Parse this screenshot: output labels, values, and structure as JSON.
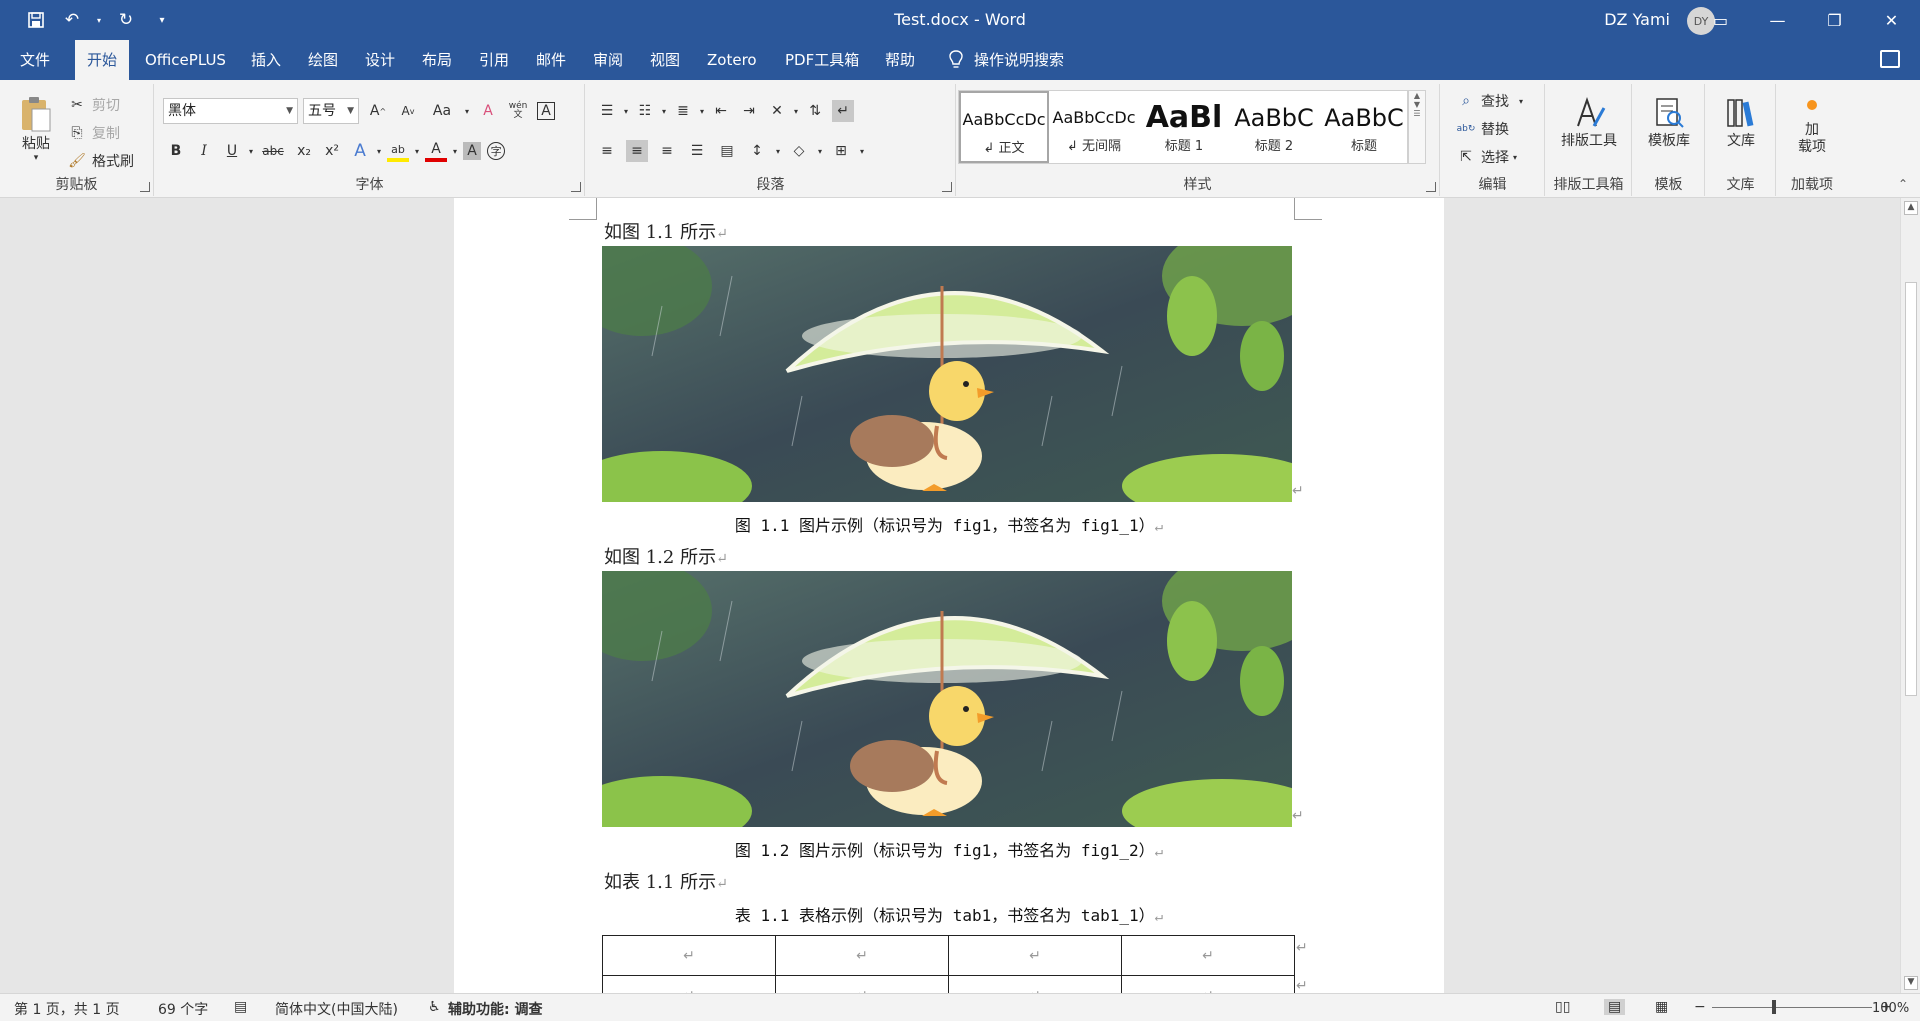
{
  "window": {
    "title": "Test.docx - Word",
    "user_name": "DZ Yami",
    "user_initials": "DY"
  },
  "tabs": [
    {
      "label": "文件"
    },
    {
      "label": "开始"
    },
    {
      "label": "OfficePLUS"
    },
    {
      "label": "插入"
    },
    {
      "label": "绘图"
    },
    {
      "label": "设计"
    },
    {
      "label": "布局"
    },
    {
      "label": "引用"
    },
    {
      "label": "邮件"
    },
    {
      "label": "审阅"
    },
    {
      "label": "视图"
    },
    {
      "label": "Zotero"
    },
    {
      "label": "PDF工具箱"
    },
    {
      "label": "帮助"
    }
  ],
  "active_tab": "开始",
  "tell_me": "操作说明搜索",
  "clipboard": {
    "paste": "粘贴",
    "cut": "剪切",
    "copy": "复制",
    "format_painter": "格式刷",
    "label": "剪贴板"
  },
  "font": {
    "name": "黑体",
    "size": "五号",
    "label": "字体",
    "change_case": "Aa",
    "bold": "B",
    "italic": "I",
    "underline": "U",
    "strikethrough": "abc",
    "subscript": "x₂",
    "superscript": "x²",
    "font_color_letter": "A",
    "phonetic": "wén"
  },
  "paragraph": {
    "label": "段落"
  },
  "styles": {
    "label": "样式",
    "items": [
      {
        "sample": "AaBbCcDc",
        "name": "↲ 正文"
      },
      {
        "sample": "AaBbCcDc",
        "name": "↲ 无间隔"
      },
      {
        "sample": "AaBl",
        "name": "标题 1"
      },
      {
        "sample": "AaBbC",
        "name": "标题 2"
      },
      {
        "sample": "AaBbC",
        "name": "标题"
      }
    ]
  },
  "editing": {
    "find": "查找",
    "replace": "替换",
    "select": "选择",
    "label": "编辑"
  },
  "extra_groups": [
    {
      "button": "排版工具",
      "label": "排版工具箱"
    },
    {
      "button": "模板库",
      "label": "模板"
    },
    {
      "button": "文库",
      "label": "文库"
    },
    {
      "button": "加\n载项",
      "label": "加载项"
    }
  ],
  "document": {
    "para1": "如图 1.1 所示",
    "caption1": "图 1.1  图片示例（标识号为 fig1，书签名为 fig1_1）",
    "para2": "如图 1.2 所示",
    "caption2": "图 1.2  图片示例（标识号为 fig1，书签名为 fig1_2）",
    "para3": "如表 1.1 所示",
    "table_caption": "表 1.1  表格示例（标识号为 tab1，书签名为 tab1_1）",
    "para_mark": "↵"
  },
  "status": {
    "page": "第 1 页，共 1 页",
    "words": "69 个字",
    "language": "简体中文(中国大陆)",
    "accessibility": "辅助功能: 调查",
    "zoom": "100%"
  },
  "colors": {
    "title_bar": "#2b579a",
    "ribbon": "#f3f3f3",
    "workspace": "#e6e6e6"
  }
}
